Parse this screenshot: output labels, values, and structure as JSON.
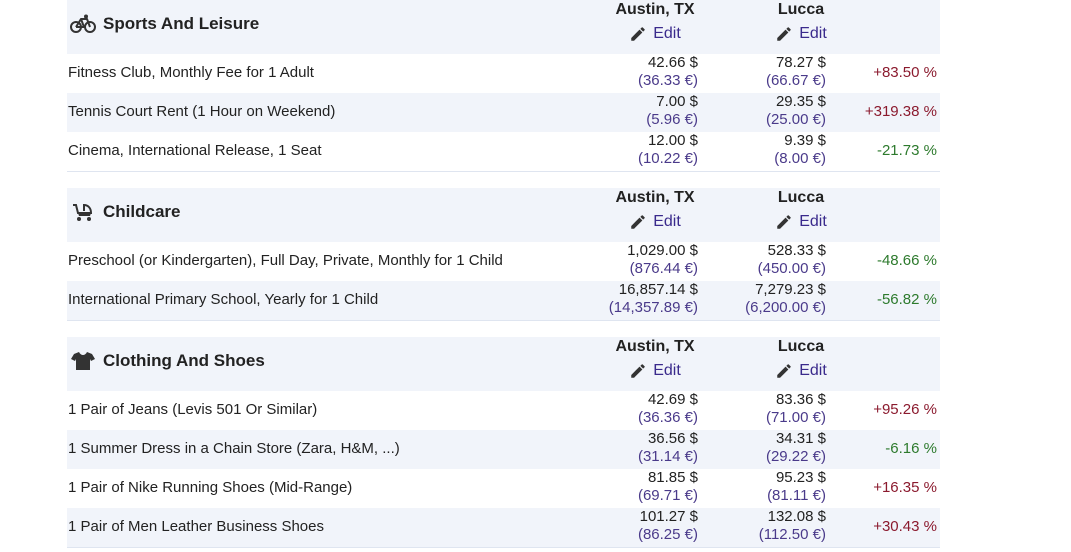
{
  "city_a": "Austin, TX",
  "city_b": "Lucca",
  "edit_label": "Edit",
  "sections": [
    {
      "title": "Sports And Leisure",
      "icon": "bicycle-icon",
      "rows": [
        {
          "label": "Fitness Club, Monthly Fee for 1 Adult",
          "a_usd": "42.66 $",
          "a_eur": "(36.33 €)",
          "b_usd": "78.27 $",
          "b_eur": "(66.67 €)",
          "diff": "+83.50 %"
        },
        {
          "label": "Tennis Court Rent (1 Hour on Weekend)",
          "a_usd": "7.00 $",
          "a_eur": "(5.96 €)",
          "b_usd": "29.35 $",
          "b_eur": "(25.00 €)",
          "diff": "+319.38 %"
        },
        {
          "label": "Cinema, International Release, 1 Seat",
          "a_usd": "12.00 $",
          "a_eur": "(10.22 €)",
          "b_usd": "9.39 $",
          "b_eur": "(8.00 €)",
          "diff": "-21.73 %"
        }
      ]
    },
    {
      "title": "Childcare",
      "icon": "stroller-icon",
      "rows": [
        {
          "label": "Preschool (or Kindergarten), Full Day, Private, Monthly for 1 Child",
          "a_usd": "1,029.00 $",
          "a_eur": "(876.44 €)",
          "b_usd": "528.33 $",
          "b_eur": "(450.00 €)",
          "diff": "-48.66 %"
        },
        {
          "label": "International Primary School, Yearly for 1 Child",
          "a_usd": "16,857.14 $",
          "a_eur": "(14,357.89 €)",
          "b_usd": "7,279.23 $",
          "b_eur": "(6,200.00 €)",
          "diff": "-56.82 %"
        }
      ]
    },
    {
      "title": "Clothing And Shoes",
      "icon": "tshirt-icon",
      "rows": [
        {
          "label": "1 Pair of Jeans (Levis 501 Or Similar)",
          "a_usd": "42.69 $",
          "a_eur": "(36.36 €)",
          "b_usd": "83.36 $",
          "b_eur": "(71.00 €)",
          "diff": "+95.26 %"
        },
        {
          "label": "1 Summer Dress in a Chain Store (Zara, H&M, ...)",
          "a_usd": "36.56 $",
          "a_eur": "(31.14 €)",
          "b_usd": "34.31 $",
          "b_eur": "(29.22 €)",
          "diff": "-6.16 %"
        },
        {
          "label": "1 Pair of Nike Running Shoes (Mid-Range)",
          "a_usd": "81.85 $",
          "a_eur": "(69.71 €)",
          "b_usd": "95.23 $",
          "b_eur": "(81.11 €)",
          "diff": "+16.35 %"
        },
        {
          "label": "1 Pair of Men Leather Business Shoes",
          "a_usd": "101.27 $",
          "a_eur": "(86.25 €)",
          "b_usd": "132.08 $",
          "b_eur": "(112.50 €)",
          "diff": "+30.43 %"
        }
      ]
    }
  ],
  "colors": {
    "positive": "#8b1a2e",
    "negative": "#2d7a2d",
    "edit_link": "#3a2a8c",
    "header_bg": "#f1f4fa"
  }
}
